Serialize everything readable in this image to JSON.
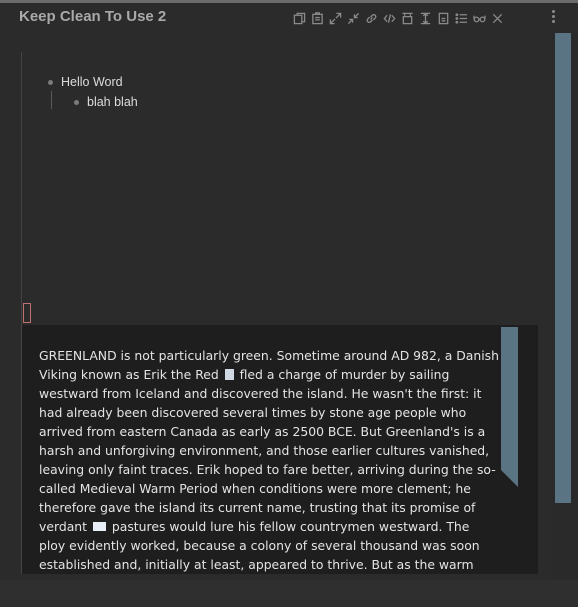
{
  "header": {
    "title": "Keep Clean To Use 2",
    "toolbar": [
      {
        "name": "copy-icon",
        "glyph": "⎘"
      },
      {
        "name": "paste-icon",
        "glyph": "⎗"
      },
      {
        "name": "expand-icon",
        "glyph": "⤢"
      },
      {
        "name": "collapse-icon",
        "glyph": "⤡"
      },
      {
        "name": "link-icon",
        "glyph": "🔗"
      },
      {
        "name": "code-icon",
        "glyph": "</>"
      },
      {
        "name": "align-top-icon",
        "glyph": "⊤"
      },
      {
        "name": "text-cursor-icon",
        "glyph": "I"
      },
      {
        "name": "align-bottom-icon",
        "glyph": "⊥"
      },
      {
        "name": "list-icon",
        "glyph": "☰"
      },
      {
        "name": "glasses-icon",
        "glyph": "⌓"
      },
      {
        "name": "close-icon",
        "glyph": "✕"
      }
    ]
  },
  "outline": {
    "items": [
      {
        "label": "Hello Word",
        "children": [
          {
            "label": "blah blah"
          }
        ]
      }
    ]
  },
  "text_block": {
    "segments": [
      "GREENLAND is not particularly green. Sometime around AD 982, a Danish Viking known as Erik the Red ",
      " fled a charge of murder by sailing westward from Iceland and discovered the island. He wasn't the first: it had already been discovered several times by stone age people who arrived from eastern Canada as early as 2500 BCE. But Greenland's is a harsh and unforgiving environment, and those earlier cultures vanished, leaving only faint traces. Erik hoped to fare better, arriving during the so-called Medieval Warm Period when conditions were more clement; he therefore gave the island its current name, trusting that its promise of verdant ",
      " pastures would lure his fellow countrymen westward. The ploy evidently worked, because a colony of several thousand was soon established and, initially at least, appeared to thrive. But as the warm period waned Greenland returned"
    ]
  },
  "colors": {
    "accent_scroll": "#5b7484",
    "background": "#2b2b2b",
    "pane_background": "#1e1e1e"
  }
}
